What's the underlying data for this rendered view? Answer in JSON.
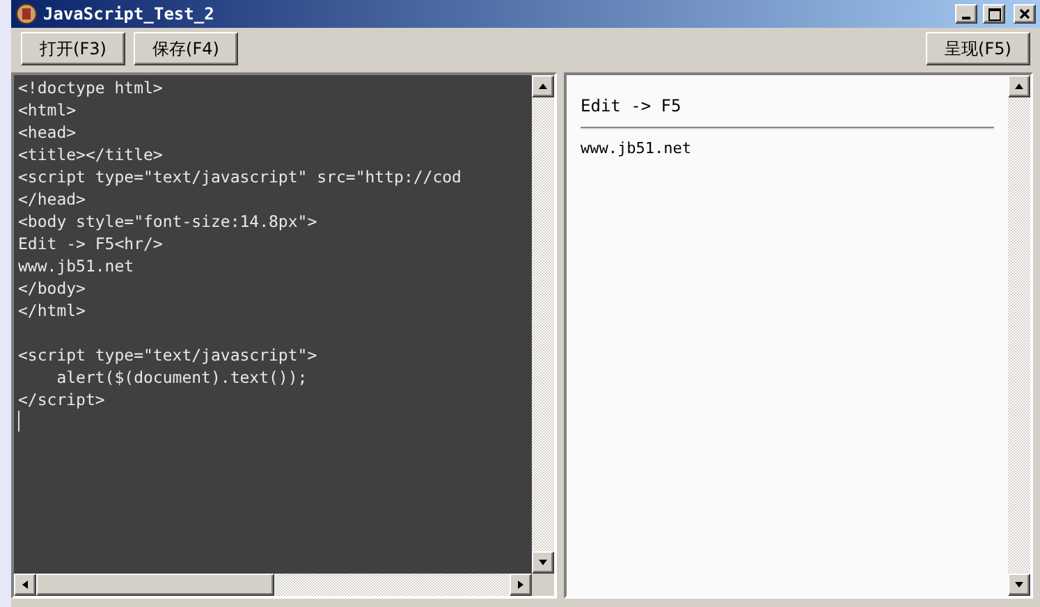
{
  "window": {
    "title": "JavaScript_Test_2"
  },
  "toolbar": {
    "left_buttons": [
      "打开(F3)",
      "保存(F4)"
    ],
    "right_buttons": [
      "呈现(F5)"
    ]
  },
  "editor": {
    "code_blocks": [
      [
        "<!doctype html>",
        "<html>",
        "<head>",
        "<title></title>",
        "<script type=\"text/javascript\" src=\"http://cod",
        "</head>",
        "<body style=\"font-size:14.8px\">",
        "Edit -> F5<hr/>",
        "www.jb51.net",
        "</body>",
        "</html>"
      ],
      [
        "<script type=\"text/javascript\">",
        "    alert($(document).text());",
        "</script>"
      ]
    ]
  },
  "preview": {
    "heading": "Edit -> F5",
    "body": "www.jb51.net"
  }
}
